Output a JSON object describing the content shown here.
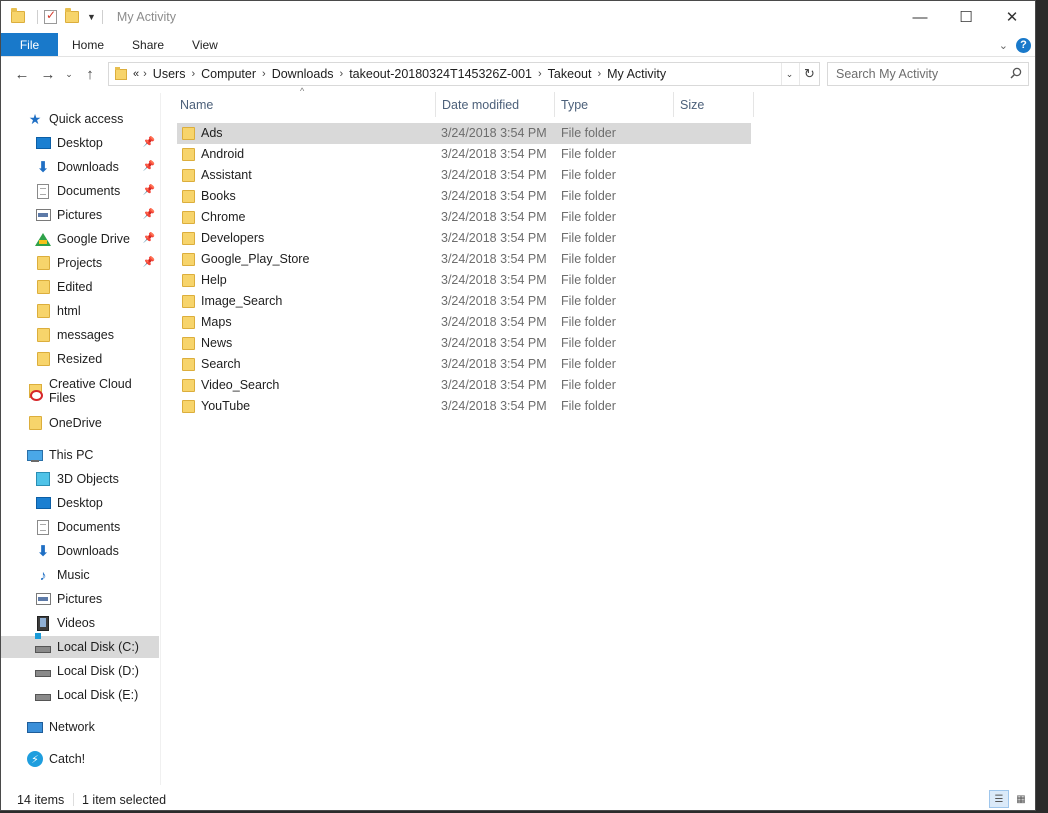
{
  "window": {
    "title": "My Activity",
    "controls": {
      "minimize": "—",
      "maximize": "☐",
      "close": "✕"
    }
  },
  "ribbon": {
    "file": "File",
    "tabs": [
      "Home",
      "Share",
      "View"
    ]
  },
  "address": {
    "prefix": "«",
    "crumbs": [
      "Users",
      "Computer",
      "Downloads",
      "takeout-20180324T145326Z-001",
      "Takeout",
      "My Activity"
    ]
  },
  "search": {
    "placeholder": "Search My Activity"
  },
  "nav": {
    "quick_access": "Quick access",
    "quick_items": [
      {
        "label": "Desktop",
        "icon": "desktop-icon",
        "pinned": true
      },
      {
        "label": "Downloads",
        "icon": "downloads-icon",
        "pinned": true
      },
      {
        "label": "Documents",
        "icon": "documents-icon",
        "pinned": true
      },
      {
        "label": "Pictures",
        "icon": "pictures-icon",
        "pinned": true
      },
      {
        "label": "Google Drive",
        "icon": "google-drive-icon",
        "pinned": true
      },
      {
        "label": "Projects",
        "icon": "folder-icon",
        "pinned": true
      },
      {
        "label": "Edited",
        "icon": "folder-icon",
        "pinned": false
      },
      {
        "label": "html",
        "icon": "folder-icon",
        "pinned": false
      },
      {
        "label": "messages",
        "icon": "folder-icon",
        "pinned": false
      },
      {
        "label": "Resized",
        "icon": "folder-icon",
        "pinned": false
      }
    ],
    "creative_cloud": "Creative Cloud Files",
    "onedrive": "OneDrive",
    "this_pc": "This PC",
    "pc_items": [
      {
        "label": "3D Objects",
        "icon": "3d-objects-icon"
      },
      {
        "label": "Desktop",
        "icon": "desktop-icon"
      },
      {
        "label": "Documents",
        "icon": "documents-icon"
      },
      {
        "label": "Downloads",
        "icon": "downloads-icon"
      },
      {
        "label": "Music",
        "icon": "music-icon"
      },
      {
        "label": "Pictures",
        "icon": "pictures-icon"
      },
      {
        "label": "Videos",
        "icon": "videos-icon"
      },
      {
        "label": "Local Disk (C:)",
        "icon": "local-disk-c-icon",
        "selected": true
      },
      {
        "label": "Local Disk (D:)",
        "icon": "local-disk-icon"
      },
      {
        "label": "Local Disk (E:)",
        "icon": "local-disk-icon"
      }
    ],
    "network": "Network",
    "catch": "Catch!"
  },
  "columns": {
    "name": "Name",
    "date": "Date modified",
    "type": "Type",
    "size": "Size"
  },
  "files": [
    {
      "name": "Ads",
      "date": "3/24/2018 3:54 PM",
      "type": "File folder",
      "selected": true
    },
    {
      "name": "Android",
      "date": "3/24/2018 3:54 PM",
      "type": "File folder"
    },
    {
      "name": "Assistant",
      "date": "3/24/2018 3:54 PM",
      "type": "File folder"
    },
    {
      "name": "Books",
      "date": "3/24/2018 3:54 PM",
      "type": "File folder"
    },
    {
      "name": "Chrome",
      "date": "3/24/2018 3:54 PM",
      "type": "File folder"
    },
    {
      "name": "Developers",
      "date": "3/24/2018 3:54 PM",
      "type": "File folder"
    },
    {
      "name": "Google_Play_Store",
      "date": "3/24/2018 3:54 PM",
      "type": "File folder"
    },
    {
      "name": "Help",
      "date": "3/24/2018 3:54 PM",
      "type": "File folder"
    },
    {
      "name": "Image_Search",
      "date": "3/24/2018 3:54 PM",
      "type": "File folder"
    },
    {
      "name": "Maps",
      "date": "3/24/2018 3:54 PM",
      "type": "File folder"
    },
    {
      "name": "News",
      "date": "3/24/2018 3:54 PM",
      "type": "File folder"
    },
    {
      "name": "Search",
      "date": "3/24/2018 3:54 PM",
      "type": "File folder"
    },
    {
      "name": "Video_Search",
      "date": "3/24/2018 3:54 PM",
      "type": "File folder"
    },
    {
      "name": "YouTube",
      "date": "3/24/2018 3:54 PM",
      "type": "File folder"
    }
  ],
  "status": {
    "count": "14 items",
    "selection": "1 item selected"
  },
  "colors": {
    "accent": "#1979ca",
    "selection": "#d9d9d9",
    "folder": "#f7d46b"
  }
}
